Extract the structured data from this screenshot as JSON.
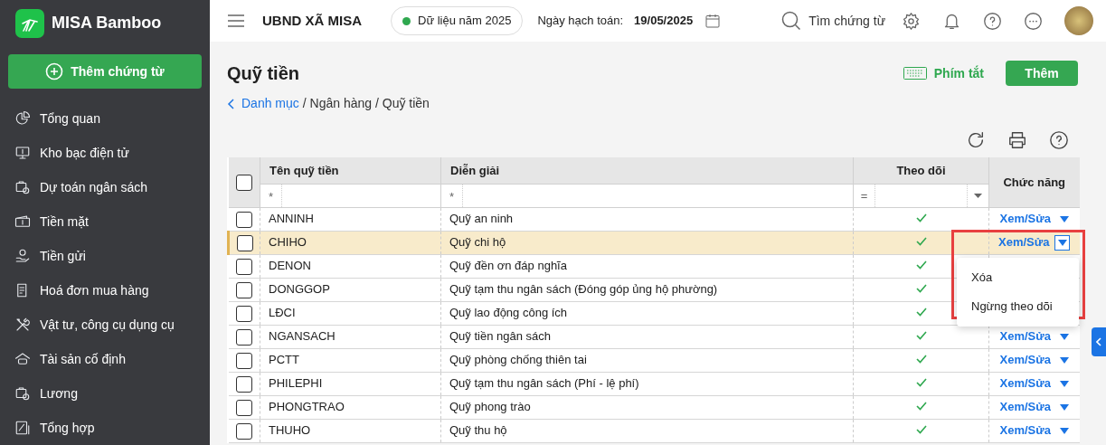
{
  "brand": {
    "name": "MISA Bamboo"
  },
  "sidebar": {
    "new_button": "Thêm chứng từ",
    "items": [
      {
        "label": "Tổng quan"
      },
      {
        "label": "Kho bạc điện tử"
      },
      {
        "label": "Dự toán ngân sách"
      },
      {
        "label": "Tiền mặt"
      },
      {
        "label": "Tiền gửi"
      },
      {
        "label": "Hoá đơn mua hàng"
      },
      {
        "label": "Vật tư, công cụ dụng cụ"
      },
      {
        "label": "Tài sản cố định"
      },
      {
        "label": "Lương"
      },
      {
        "label": "Tổng hợp"
      }
    ]
  },
  "header": {
    "org": "UBND XÃ MISA",
    "data_year": "Dữ liệu năm 2025",
    "date_label": "Ngày hạch toán:",
    "date": "19/05/2025",
    "search": "Tìm chứng từ"
  },
  "page": {
    "title": "Quỹ tiền",
    "breadcrumb": {
      "link": "Danh mục",
      "path": "/ Ngân hàng / Quỹ tiền"
    },
    "shortcut": "Phím tắt",
    "add_button": "Thêm"
  },
  "table": {
    "columns": [
      "Tên quỹ tiền",
      "Diễn giải",
      "Theo dõi",
      "Chức năng"
    ],
    "select_all_checked": false,
    "filters": {
      "name": "*",
      "desc": "*",
      "follow_op": "="
    },
    "rows": [
      {
        "code": "ANNINH",
        "desc": "Quỹ an ninh",
        "followed": true,
        "checked": false,
        "selected": false,
        "action": "Xem/Sửa"
      },
      {
        "code": "CHIHO",
        "desc": "Quỹ chi hộ",
        "followed": true,
        "checked": false,
        "selected": true,
        "action": "Xem/Sửa"
      },
      {
        "code": "DENON",
        "desc": "Quỹ đền ơn đáp nghĩa",
        "followed": true,
        "checked": false,
        "selected": false
      },
      {
        "code": "DONGGOP",
        "desc": "Quỹ tạm thu ngân sách (Đóng góp ủng hộ phường)",
        "followed": true,
        "checked": false,
        "selected": false
      },
      {
        "code": "LĐCI",
        "desc": "Quỹ lao động công ích",
        "followed": true,
        "checked": false,
        "selected": false
      },
      {
        "code": "NGANSACH",
        "desc": "Quỹ tiền ngân sách",
        "followed": true,
        "checked": false,
        "selected": false,
        "action": "Xem/Sửa"
      },
      {
        "code": "PCTT",
        "desc": "Quỹ phòng chống thiên tai",
        "followed": true,
        "checked": false,
        "selected": false,
        "action": "Xem/Sửa"
      },
      {
        "code": "PHILEPHI",
        "desc": "Quỹ tạm thu ngân sách (Phí - lệ phí)",
        "followed": true,
        "checked": false,
        "selected": false,
        "action": "Xem/Sửa"
      },
      {
        "code": "PHONGTRAO",
        "desc": "Quỹ phong trào",
        "followed": true,
        "checked": false,
        "selected": false,
        "action": "Xem/Sửa"
      },
      {
        "code": "THUHO",
        "desc": "Quỹ thu hộ",
        "followed": true,
        "checked": false,
        "selected": false,
        "action": "Xem/Sửa"
      }
    ]
  },
  "action_menu": {
    "items": [
      "Xóa",
      "Ngừng theo dõi"
    ]
  }
}
